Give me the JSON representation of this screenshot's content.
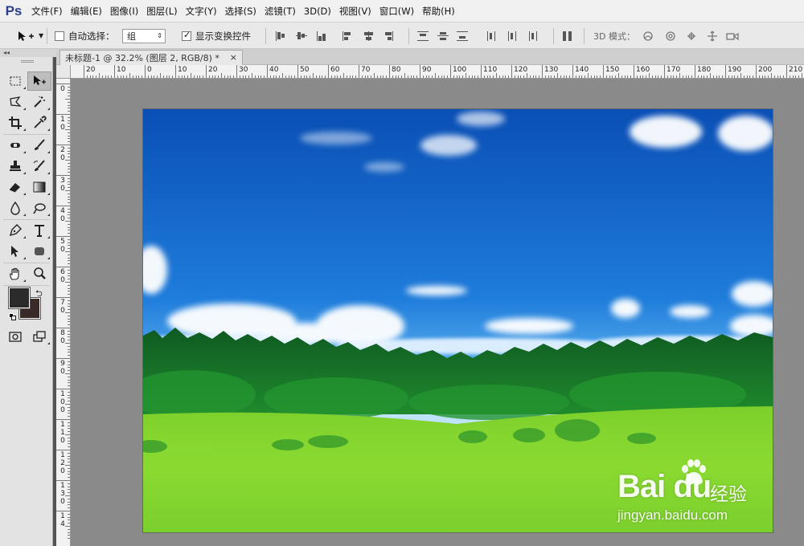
{
  "app": {
    "logo": "Ps"
  },
  "menu": [
    "文件(F)",
    "编辑(E)",
    "图像(I)",
    "图层(L)",
    "文字(Y)",
    "选择(S)",
    "滤镜(T)",
    "3D(D)",
    "视图(V)",
    "窗口(W)",
    "帮助(H)"
  ],
  "options": {
    "auto_select_label": "自动选择：",
    "auto_select_checked": false,
    "auto_select_target": "组",
    "show_transform_label": "显示变换控件",
    "show_transform_checked": true,
    "mode_3d_label": "3D 模式："
  },
  "panel_collapse": "◂◂",
  "document": {
    "tab_title": "未标题-1 @ 32.2% (图层 2, RGB/8) *",
    "close": "×"
  },
  "ruler": {
    "h_labels": [
      "20",
      "10",
      "0",
      "10",
      "20",
      "30",
      "40",
      "50",
      "60",
      "70",
      "80",
      "90",
      "100",
      "110",
      "120",
      "130",
      "140",
      "150",
      "160",
      "170",
      "180",
      "190",
      "200",
      "210"
    ],
    "v_labels": [
      "0",
      "1 0",
      "2 0",
      "3 0",
      "4 0",
      "5 0",
      "6 0",
      "7 0",
      "8 0",
      "9 0",
      "1 0 0",
      "1 1 0",
      "1 2 0",
      "1 3 0",
      "1 4"
    ]
  },
  "watermark": {
    "logo": "Bai du",
    "cn": "经验",
    "url": "jingyan.baidu.com"
  },
  "colors": {
    "foreground": "#2b2b2b",
    "background": "#3a2a27",
    "sky_top": "#0a4fb5",
    "grass": "#7ccf2a"
  }
}
